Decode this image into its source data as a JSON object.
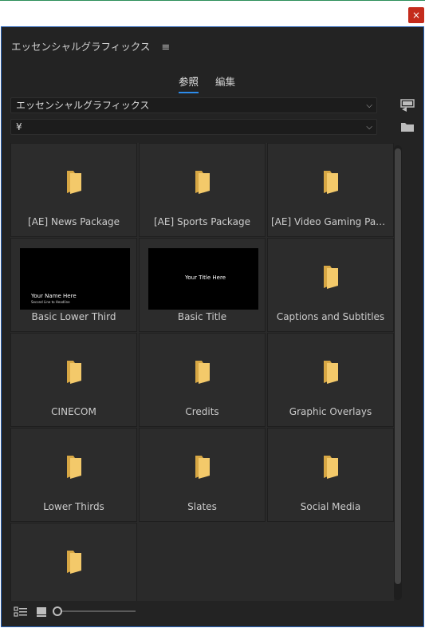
{
  "window": {
    "close_label": "×"
  },
  "panel": {
    "title": "エッセンシャルグラフィックス",
    "menu_icon": "≡"
  },
  "tabs": [
    {
      "label": "参照",
      "active": true
    },
    {
      "label": "編集",
      "active": false
    }
  ],
  "location_select": {
    "value": "エッセンシャルグラフィックス"
  },
  "path_select": {
    "value": "¥"
  },
  "chevron": "⌵",
  "tiles": [
    {
      "label": "[AE] News Package",
      "type": "folder"
    },
    {
      "label": "[AE] Sports Package",
      "type": "folder"
    },
    {
      "label": "[AE] Video Gaming Pack...",
      "type": "folder"
    },
    {
      "label": "Basic Lower Third",
      "type": "thumb",
      "thumb_text": "Your Name Here",
      "thumb_sub": "Second Line to Headline"
    },
    {
      "label": "Basic Title",
      "type": "thumb",
      "thumb_text": "Your Title Here"
    },
    {
      "label": "Captions and Subtitles",
      "type": "folder"
    },
    {
      "label": "CINECOM",
      "type": "folder"
    },
    {
      "label": "Credits",
      "type": "folder"
    },
    {
      "label": "Graphic Overlays",
      "type": "folder"
    },
    {
      "label": "Lower Thirds",
      "type": "folder"
    },
    {
      "label": "Slates",
      "type": "folder"
    },
    {
      "label": "Social Media",
      "type": "folder"
    },
    {
      "label": "",
      "type": "folder"
    }
  ],
  "colors": {
    "accent": "#2d8ceb",
    "folder": "#f3c96a",
    "folder_dark": "#d7a744",
    "close": "#c42b1c"
  }
}
